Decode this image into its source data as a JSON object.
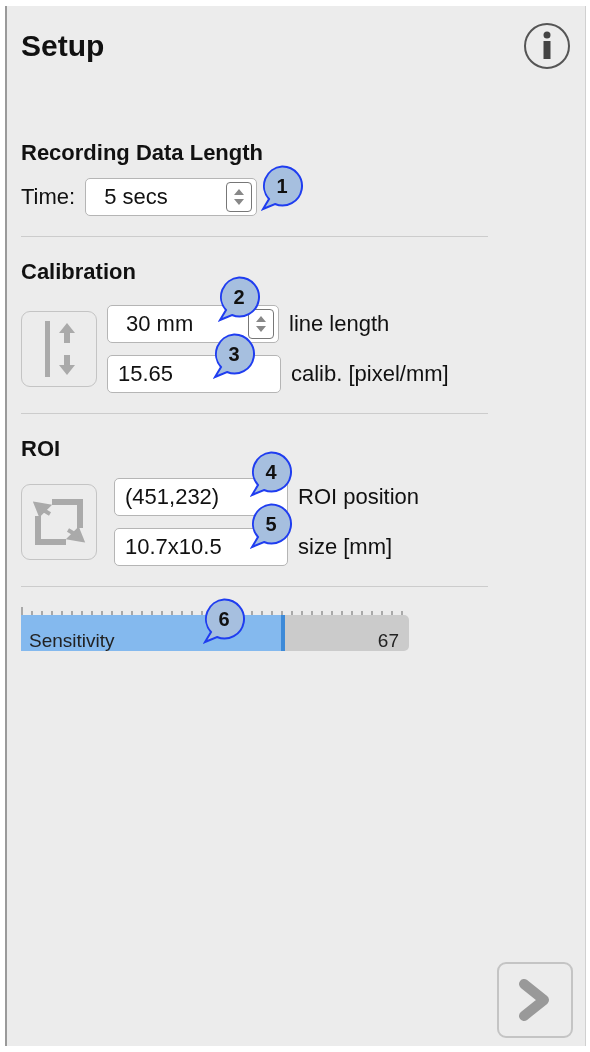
{
  "title": "Setup",
  "recording": {
    "heading": "Recording Data Length",
    "label": "Time:",
    "value": "5 secs"
  },
  "calibration": {
    "heading": "Calibration",
    "line_length": {
      "value": "30 mm",
      "label": "line length"
    },
    "calib": {
      "value": "15.65",
      "label": "calib. [pixel/mm]"
    }
  },
  "roi": {
    "heading": "ROI",
    "position": {
      "value": "(451,232)",
      "label": "ROI position"
    },
    "size": {
      "value": "10.7x10.5",
      "label": "size [mm]"
    }
  },
  "sensitivity": {
    "label": "Sensitivity",
    "reading": "67",
    "level": 0.67
  },
  "callouts": [
    "1",
    "2",
    "3",
    "4",
    "5",
    "6"
  ]
}
